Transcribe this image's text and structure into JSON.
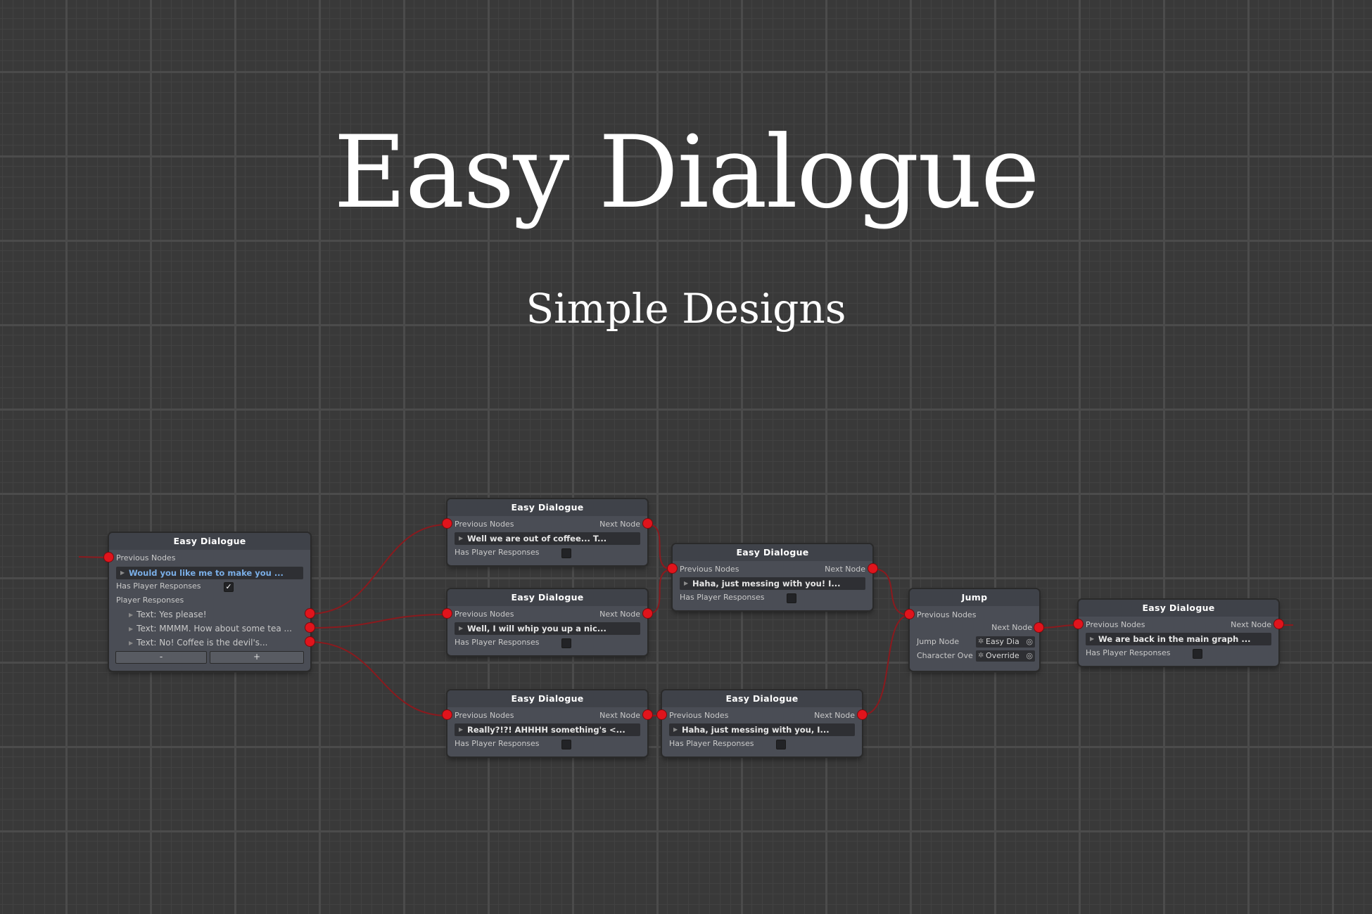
{
  "hero": {
    "title": "Easy Dialogue",
    "subtitle": "Simple Designs"
  },
  "colors": {
    "port": "#e0141c",
    "wire": "#8a1a1e",
    "node_body": "#4a4d55",
    "node_header": "#3f4249",
    "highlight_text": "#7aaee6"
  },
  "icons": {
    "collapse": "triangle-right-icon",
    "check": "checkmark-icon",
    "object_picker": "target-icon"
  },
  "nodes": {
    "n1": {
      "header": "Easy Dialogue",
      "prev": "Previous Nodes",
      "text": "Would you like me to make you ...",
      "has_player": "Has Player Responses",
      "has_player_checked": true,
      "player_responses": "Player Responses",
      "responses": [
        "Text: Yes please!",
        "Text: MMMM. How about some tea ...",
        "Text: No! Coffee is the devil's..."
      ],
      "minus": "-",
      "plus": "+"
    },
    "n2": {
      "header": "Easy Dialogue",
      "prev": "Previous Nodes",
      "next": "Next Node",
      "text": "Well we are out of coffee... T...",
      "has_player": "Has Player Responses"
    },
    "n3": {
      "header": "Easy Dialogue",
      "prev": "Previous Nodes",
      "next": "Next Node",
      "text": "Well, I will whip you up a nic...",
      "has_player": "Has Player Responses"
    },
    "n4": {
      "header": "Easy Dialogue",
      "prev": "Previous Nodes",
      "next": "Next Node",
      "text": "Really?!?! AHHHH something's <...",
      "has_player": "Has Player Responses"
    },
    "n5": {
      "header": "Easy Dialogue",
      "prev": "Previous Nodes",
      "next": "Next Node",
      "text": "Haha, just messing with you! I...",
      "has_player": "Has Player Responses"
    },
    "n6": {
      "header": "Easy Dialogue",
      "prev": "Previous Nodes",
      "next": "Next Node",
      "text": "Haha, just messing with you, I...",
      "has_player": "Has Player Responses"
    },
    "jump": {
      "header": "Jump",
      "prev": "Previous Nodes",
      "next": "Next Node",
      "jump_label": "Jump Node",
      "jump_value": "Easy Dia",
      "char_label": "Character Ove",
      "char_value": "Override"
    },
    "n7": {
      "header": "Easy Dialogue",
      "prev": "Previous Nodes",
      "next": "Next Node",
      "text": "We are back in the main graph ...",
      "has_player": "Has Player Responses"
    }
  }
}
